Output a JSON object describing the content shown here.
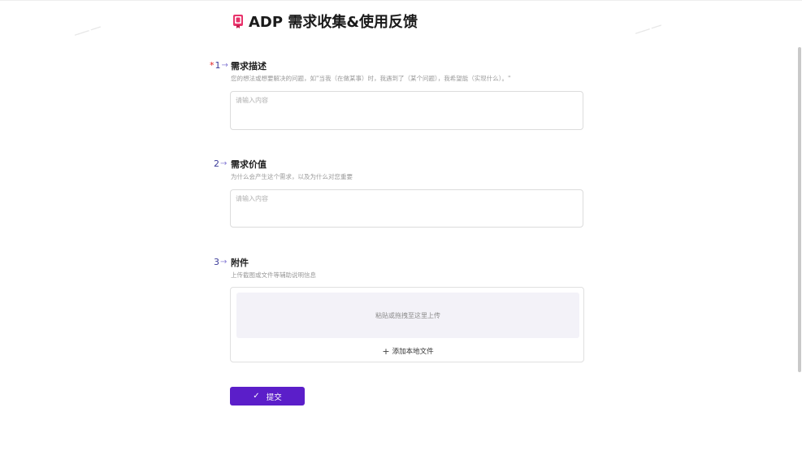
{
  "header": {
    "title": "ADP 需求收集&使用反馈",
    "icon": "book-icon"
  },
  "questions": [
    {
      "number": "1",
      "required": true,
      "required_mark": "*",
      "label": "需求描述",
      "description": "您的想法或想要解决的问题，如\"当我（在做某事）时，我遇到了（某个问题），我希望能（实现什么）。\"",
      "placeholder": "请输入内容"
    },
    {
      "number": "2",
      "required": false,
      "label": "需求价值",
      "description": "为什么会产生这个需求，以及为什么对您重要",
      "placeholder": "请输入内容"
    },
    {
      "number": "3",
      "required": false,
      "label": "附件",
      "description": "上传截图或文件等辅助说明信息",
      "drop_text": "粘贴或拖拽至这里上传",
      "add_file_label": "添加本地文件"
    }
  ],
  "submit": {
    "label": "提交"
  },
  "colors": {
    "accent": "#5b1ec9",
    "required": "#e02020",
    "number": "#3b3b99"
  }
}
